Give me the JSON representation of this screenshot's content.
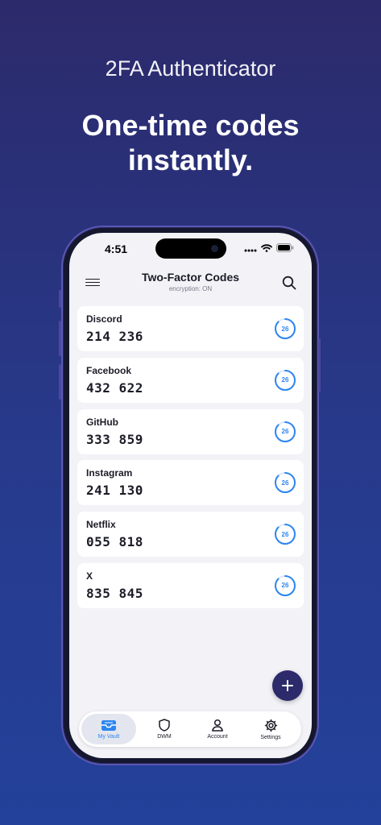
{
  "promo": {
    "subtitle": "2FA Authenticator",
    "headline_line1": "One-time codes",
    "headline_line2": "instantly."
  },
  "status_bar": {
    "time": "4:51"
  },
  "header": {
    "title": "Two-Factor Codes",
    "caption": "encryption: ON",
    "menu_icon": "hamburger-menu-icon",
    "search_icon": "search-icon"
  },
  "codes": [
    {
      "service": "Discord",
      "code": "214 236",
      "seconds_left": "26"
    },
    {
      "service": "Facebook",
      "code": "432 622",
      "seconds_left": "26"
    },
    {
      "service": "GitHub",
      "code": "333 859",
      "seconds_left": "26"
    },
    {
      "service": "Instagram",
      "code": "241 130",
      "seconds_left": "26"
    },
    {
      "service": "Netflix",
      "code": "055 818",
      "seconds_left": "26"
    },
    {
      "service": "X",
      "code": "835 845",
      "seconds_left": "26"
    }
  ],
  "timer_fraction": 0.87,
  "fab": {
    "icon": "plus-icon"
  },
  "tabs": [
    {
      "label": "My Vault",
      "icon": "vault-tray-icon",
      "active": true
    },
    {
      "label": "DWM",
      "icon": "shield-icon",
      "active": false
    },
    {
      "label": "Account",
      "icon": "person-icon",
      "active": false
    },
    {
      "label": "Settings",
      "icon": "gear-icon",
      "active": false
    }
  ],
  "colors": {
    "accent": "#2d86f0",
    "brand": "#2c2a6b",
    "background_top": "#2c2a6b",
    "background_bottom": "#23419a"
  }
}
